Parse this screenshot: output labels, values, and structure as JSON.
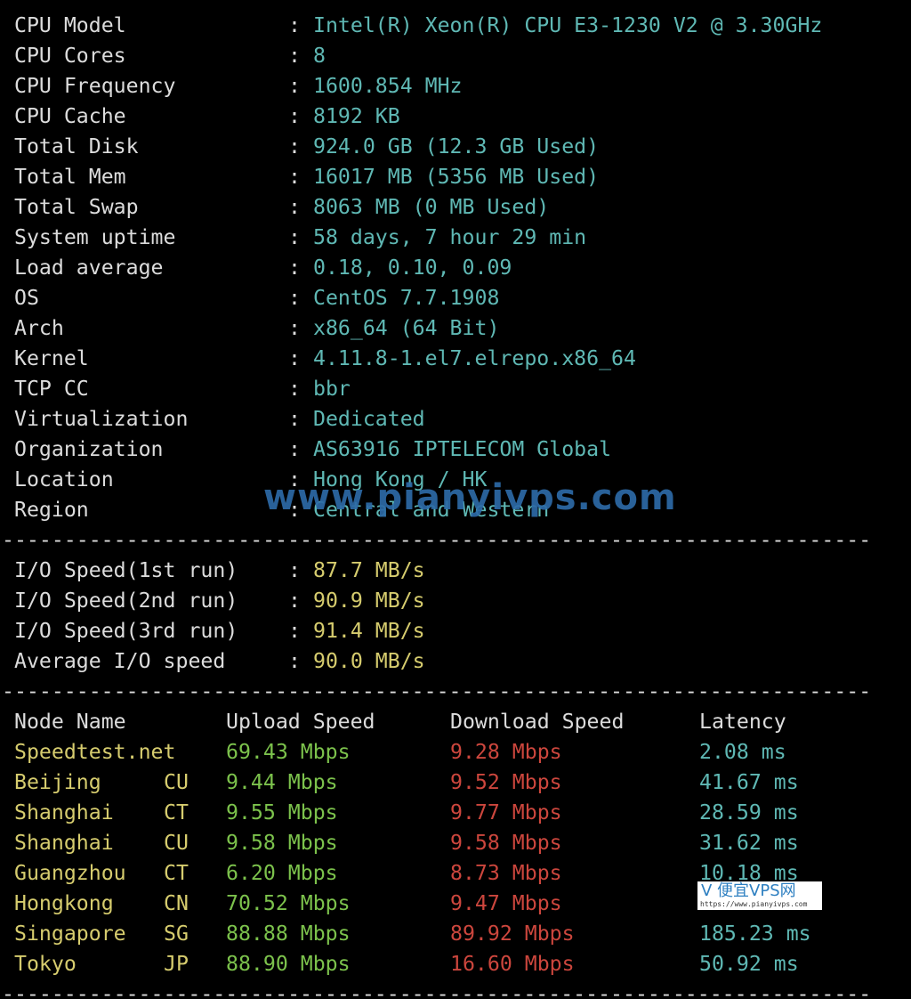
{
  "colors": {
    "label": "#dcdcdc",
    "value": "#5fb8b4",
    "io": "#d6cc6e",
    "node": "#d6cc6e",
    "upload": "#7cc24c",
    "download": "#cc463d",
    "latency": "#5fb8b4",
    "watermark": "#2d6aa6"
  },
  "separator": "----------------------------------------------------------------------",
  "sysinfo": [
    {
      "label": "CPU Model",
      "value": "Intel(R) Xeon(R) CPU E3-1230 V2 @ 3.30GHz"
    },
    {
      "label": "CPU Cores",
      "value": "8"
    },
    {
      "label": "CPU Frequency",
      "value": "1600.854 MHz"
    },
    {
      "label": "CPU Cache",
      "value": "8192 KB"
    },
    {
      "label": "Total Disk",
      "value": "924.0 GB (12.3 GB Used)"
    },
    {
      "label": "Total Mem",
      "value": "16017 MB (5356 MB Used)"
    },
    {
      "label": "Total Swap",
      "value": "8063 MB (0 MB Used)"
    },
    {
      "label": "System uptime",
      "value": "58 days, 7 hour 29 min"
    },
    {
      "label": "Load average",
      "value": "0.18, 0.10, 0.09"
    },
    {
      "label": "OS",
      "value": "CentOS 7.7.1908"
    },
    {
      "label": "Arch",
      "value": "x86_64 (64 Bit)"
    },
    {
      "label": "Kernel",
      "value": "4.11.8-1.el7.elrepo.x86_64"
    },
    {
      "label": "TCP CC",
      "value": "bbr"
    },
    {
      "label": "Virtualization",
      "value": "Dedicated"
    },
    {
      "label": "Organization",
      "value": "AS63916 IPTELECOM Global"
    },
    {
      "label": "Location",
      "value": "Hong Kong / HK"
    },
    {
      "label": "Region",
      "value": "Central and Western"
    }
  ],
  "io": [
    {
      "label": "I/O Speed(1st run)",
      "value": "87.7 MB/s"
    },
    {
      "label": "I/O Speed(2nd run)",
      "value": "90.9 MB/s"
    },
    {
      "label": "I/O Speed(3rd run)",
      "value": "91.4 MB/s"
    },
    {
      "label": "Average I/O speed",
      "value": "90.0 MB/s"
    }
  ],
  "speed_headers": {
    "node": "Node Name",
    "upload": "Upload Speed",
    "download": "Download Speed",
    "latency": "Latency"
  },
  "speed": [
    {
      "node": "Speedtest.net",
      "isp": "",
      "upload": "69.43 Mbps",
      "download": "9.28 Mbps",
      "latency": "2.08 ms"
    },
    {
      "node": "Beijing",
      "isp": "CU",
      "upload": "9.44 Mbps",
      "download": "9.52 Mbps",
      "latency": "41.67 ms"
    },
    {
      "node": "Shanghai",
      "isp": "CT",
      "upload": "9.55 Mbps",
      "download": "9.77 Mbps",
      "latency": "28.59 ms"
    },
    {
      "node": "Shanghai",
      "isp": "CU",
      "upload": "9.58 Mbps",
      "download": "9.58 Mbps",
      "latency": "31.62 ms"
    },
    {
      "node": "Guangzhou",
      "isp": "CT",
      "upload": "6.20 Mbps",
      "download": "8.73 Mbps",
      "latency": "10.18 ms"
    },
    {
      "node": "Hongkong",
      "isp": "CN",
      "upload": "70.52 Mbps",
      "download": "9.47 Mbps",
      "latency": ""
    },
    {
      "node": "Singapore",
      "isp": "SG",
      "upload": "88.88 Mbps",
      "download": "89.92 Mbps",
      "latency": "185.23 ms"
    },
    {
      "node": "Tokyo",
      "isp": "JP",
      "upload": "88.90 Mbps",
      "download": "16.60 Mbps",
      "latency": "50.92 ms"
    }
  ],
  "watermark": {
    "text": "www.pianyivps.com",
    "logo_title": "V 便宜VPS网",
    "logo_url": "https://www.pianyivps.com"
  }
}
